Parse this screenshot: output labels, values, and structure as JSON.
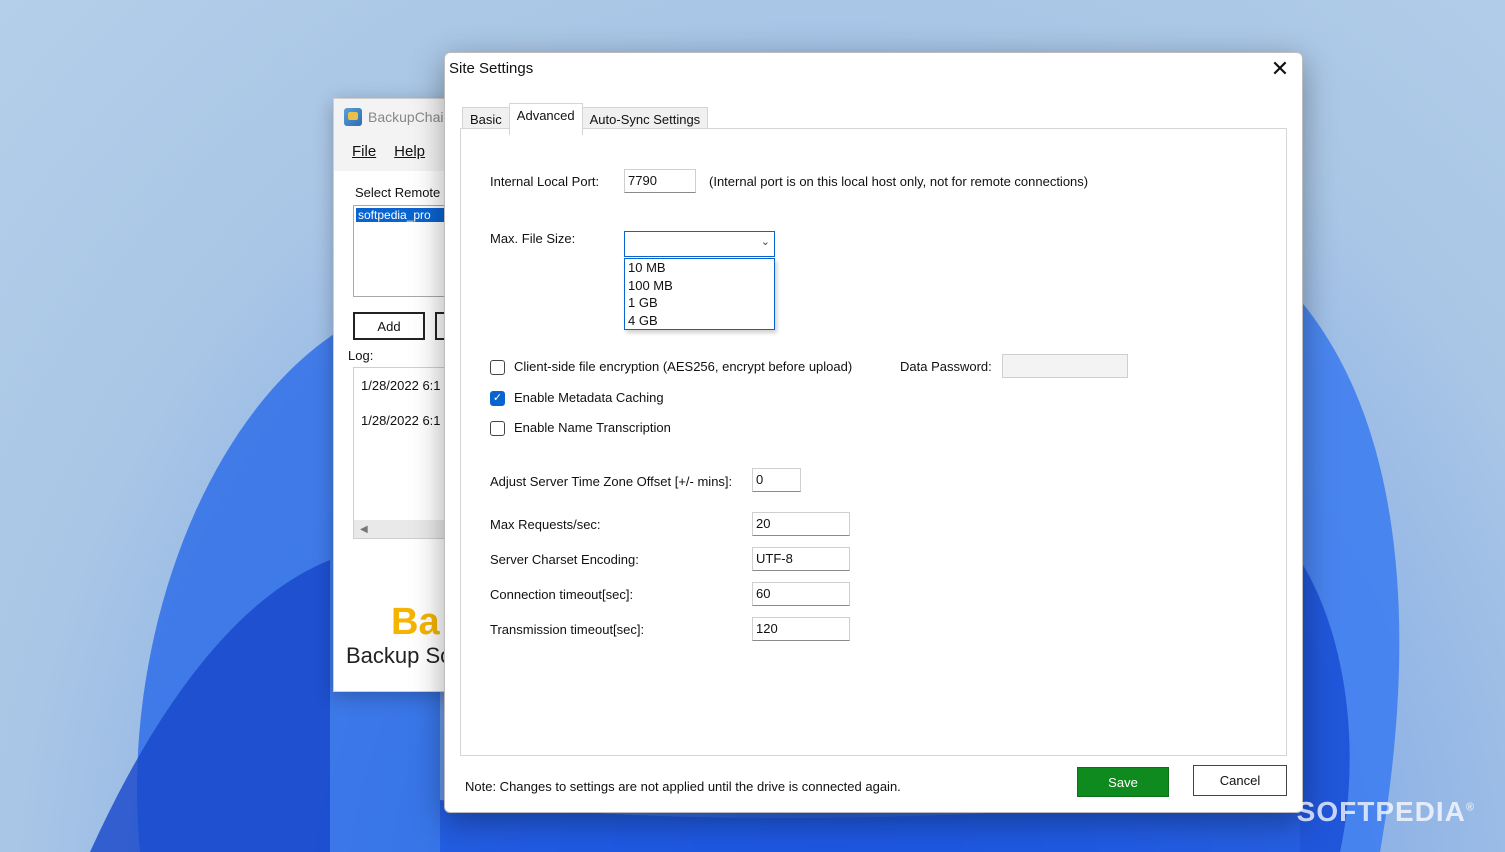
{
  "background_app": {
    "title": "BackupChai",
    "menu": {
      "file": "File",
      "help": "Help"
    },
    "select_label": "Select Remote",
    "list_item": "softpedia_pro",
    "add_label": "Add",
    "log_label": "Log:",
    "log_lines": [
      "1/28/2022 6:1",
      "1/28/2022 6:1"
    ],
    "brand_short": "Ba",
    "brand_text": "Backup Sc"
  },
  "dialog": {
    "title": "Site Settings",
    "close_glyph": "✕",
    "tabs": [
      {
        "label": "Basic",
        "active": false
      },
      {
        "label": "Advanced",
        "active": true
      },
      {
        "label": "Auto-Sync Settings",
        "active": false
      }
    ],
    "advanced": {
      "internal_port_label": "Internal Local Port:",
      "internal_port_value": "7790",
      "internal_port_note": "(Internal port is on this local host only, not for remote connections)",
      "max_file_size_label": "Max. File Size:",
      "max_file_size_value": "",
      "max_file_size_options": [
        "10 MB",
        "100 MB",
        "1 GB",
        "4 GB"
      ],
      "encryption_label": "Client-side file encryption (AES256, encrypt before upload)",
      "encryption_checked": false,
      "data_password_label": "Data Password:",
      "metadata_label": "Enable Metadata Caching",
      "metadata_checked": true,
      "name_transcription_label": "Enable Name Transcription",
      "name_transcription_checked": false,
      "tz_offset_label": "Adjust Server Time Zone Offset [+/- mins]:",
      "tz_offset_value": "0",
      "max_requests_label": "Max Requests/sec:",
      "max_requests_value": "20",
      "charset_label": "Server Charset Encoding:",
      "charset_value": "UTF-8",
      "conn_timeout_label": "Connection timeout[sec]:",
      "conn_timeout_value": "60",
      "trans_timeout_label": "Transmission timeout[sec]:",
      "trans_timeout_value": "120"
    },
    "note": "Note: Changes to settings are not applied until the drive is connected again.",
    "save_label": "Save",
    "cancel_label": "Cancel"
  },
  "watermark": "SOFTPEDIA",
  "colors": {
    "accent": "#0a64d0",
    "save_green": "#0f8a1f"
  }
}
